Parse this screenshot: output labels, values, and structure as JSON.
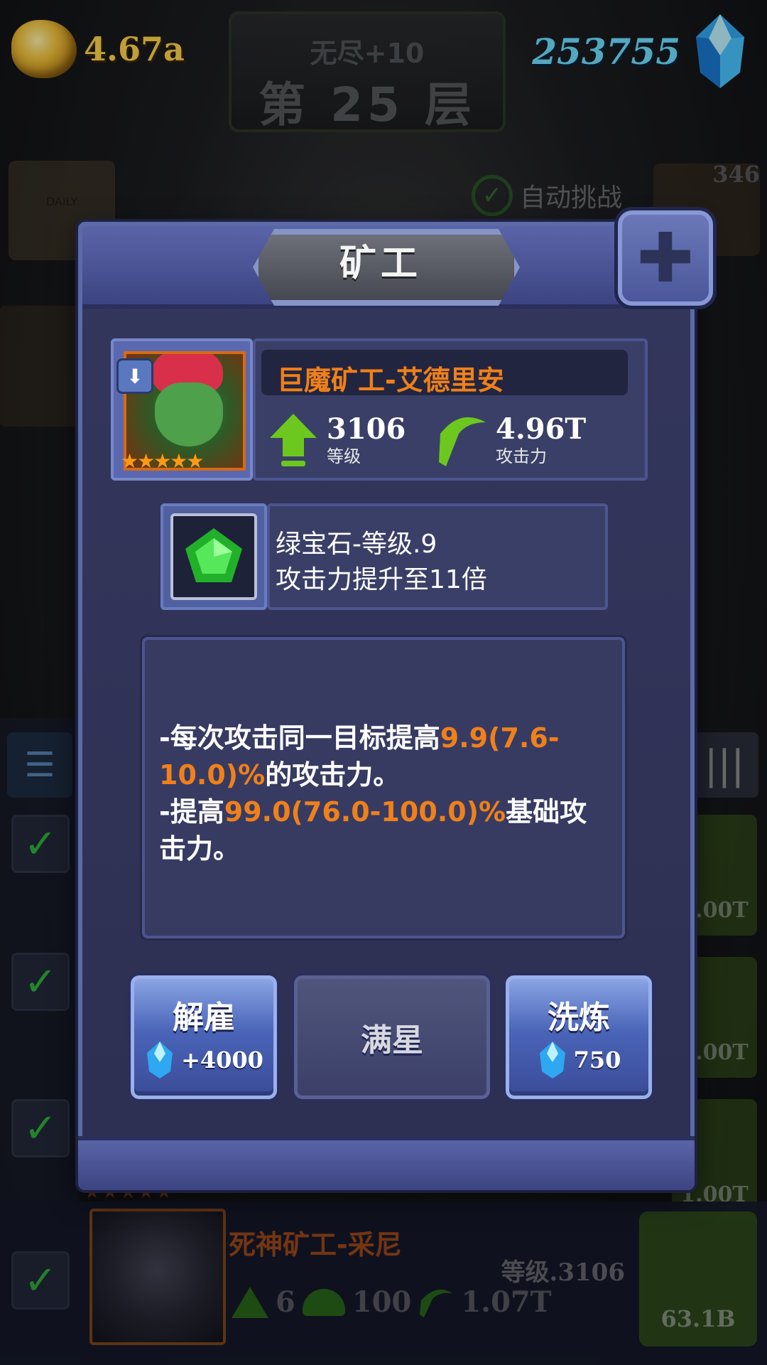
{
  "hud": {
    "gold": "4.67a",
    "gems": "253755",
    "floor_mode": "无尽+10",
    "floor_label": "第 25 层"
  },
  "background": {
    "calendar_label": "DAILY",
    "auto_challenge_label": "自动挑战",
    "chest_badge": "346",
    "right_button_values": [
      "1.00T",
      "1.00T",
      "1.00T"
    ],
    "list_row": {
      "name": "死神矿工-采尼",
      "level": "等级.3106",
      "stat_a": "6",
      "stat_b": "100",
      "attack": "1.07T",
      "cost": "63.1B"
    }
  },
  "modal": {
    "title": "矿工",
    "miner": {
      "name": "巨魔矿工-艾德里安",
      "stars": "★★★★★",
      "level_value": "3106",
      "level_label": "等级",
      "attack_value": "4.96T",
      "attack_label": "攻击力"
    },
    "gem": {
      "line1": "绿宝石-等级.9",
      "line2": "攻击力提升至11倍"
    },
    "description": {
      "l1_pre": "-每次攻击同一目标提高",
      "l1_hl": "9.9(7.6-10.0)%",
      "l1_post": "的攻击力。",
      "l2_pre": "-提高",
      "l2_hl": "99.0(76.0-100.0)%",
      "l2_post": "基础攻击力。"
    },
    "buttons": {
      "fire_label": "解雇",
      "fire_reward": "+4000",
      "full_star_label": "满星",
      "refine_label": "洗炼",
      "refine_cost": "750"
    }
  },
  "colors": {
    "accent_orange": "#f0801a",
    "gold": "#ffd44a",
    "gem_cyan": "#6fe0ff",
    "check_green": "#2fb23a"
  }
}
